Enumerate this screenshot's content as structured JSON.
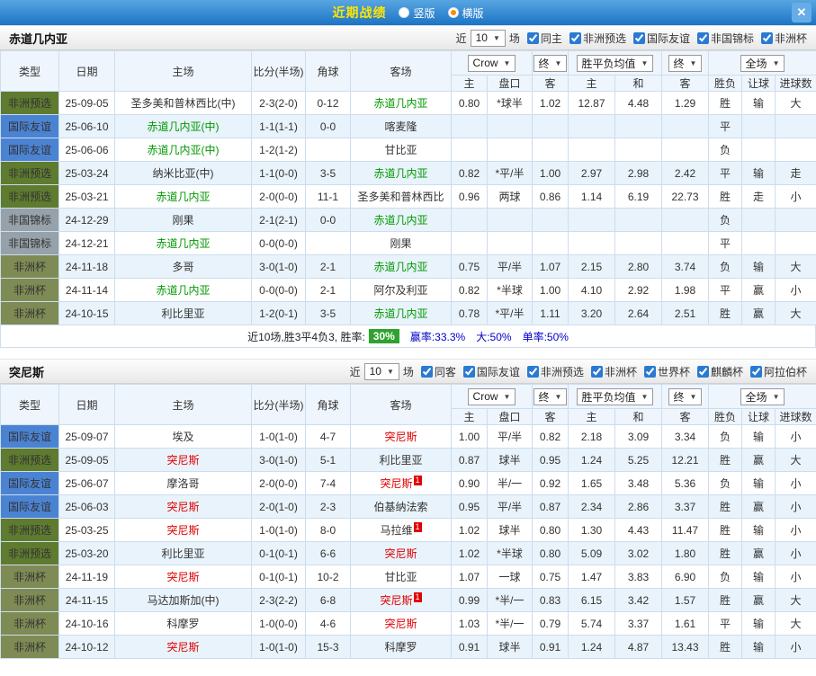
{
  "topbar": {
    "title": "近期战绩",
    "radios": [
      {
        "label": "竖版",
        "selected": false
      },
      {
        "label": "横版",
        "selected": true
      }
    ],
    "close_label": "✕"
  },
  "table_header": {
    "type": "类型",
    "date": "日期",
    "home": "主场",
    "score": "比分(半场)",
    "corners": "角球",
    "away": "客场",
    "odds_home": "主",
    "handicap": "盘口",
    "odds_away": "客",
    "eu_home": "主",
    "eu_draw": "和",
    "eu_away": "客",
    "result": "胜负",
    "let_col": "让球",
    "goals": "进球数"
  },
  "colors": {
    "accent_blue": "#1b74c4",
    "title_yellow": "#ffe400",
    "win_red": "#e00000",
    "lose_green": "#009900",
    "push_blue": "#0000cc",
    "badge_green": "#2fa32f",
    "type_preliminary_green": "#5e7b2f",
    "type_friendly_blue": "#4b83d3",
    "type_nonnational_gray": "#97a1a9",
    "type_africacup_olive": "#7f8b55"
  },
  "sections": [
    {
      "team": "赤道几内亚",
      "recent": {
        "pre": "近",
        "count": "10",
        "post": "场"
      },
      "filters": [
        {
          "label": "同主",
          "checked": true
        },
        {
          "label": "非洲预选",
          "checked": true
        },
        {
          "label": "国际友谊",
          "checked": true
        },
        {
          "label": "非国锦标",
          "checked": true
        },
        {
          "label": "非洲杯",
          "checked": true
        }
      ],
      "dropdowns": {
        "company": "Crow",
        "company_state": "终",
        "europe": "胜平负均值",
        "europe_state": "终",
        "scope": "全场"
      },
      "rows": [
        {
          "type": "非洲预选",
          "typeClass": "t-pre",
          "date": "25-09-05",
          "home": "圣多美和普林西比(中)",
          "homeClass": "",
          "homeBadge": "",
          "score": "2-3(2-0)",
          "corners": "0-12",
          "away": "赤道几内亚",
          "awayClass": "c-green",
          "awayBadge": "",
          "oh": "0.80",
          "hc": "*球半",
          "oa": "1.02",
          "eh": "12.87",
          "ed": "4.48",
          "ea": "1.29",
          "res": "胜",
          "resClass": "c-red",
          "let": "输",
          "letClass": "c-green",
          "big": "大",
          "bigClass": "c-red"
        },
        {
          "type": "国际友谊",
          "typeClass": "t-fri",
          "date": "25-06-10",
          "home": "赤道几内亚(中)",
          "homeClass": "c-green",
          "homeBadge": "",
          "score": "1-1(1-1)",
          "corners": "0-0",
          "away": "喀麦隆",
          "awayClass": "",
          "awayBadge": "",
          "oh": "",
          "hc": "",
          "oa": "",
          "eh": "",
          "ed": "",
          "ea": "",
          "res": "平",
          "resClass": "c-dark",
          "let": "",
          "letClass": "",
          "big": "",
          "bigClass": ""
        },
        {
          "type": "国际友谊",
          "typeClass": "t-fri",
          "date": "25-06-06",
          "home": "赤道几内亚(中)",
          "homeClass": "c-green",
          "homeBadge": "",
          "score": "1-2(1-2)",
          "corners": "",
          "away": "甘比亚",
          "awayClass": "",
          "awayBadge": "",
          "oh": "",
          "hc": "",
          "oa": "",
          "eh": "",
          "ed": "",
          "ea": "",
          "res": "负",
          "resClass": "c-green",
          "let": "",
          "letClass": "",
          "big": "",
          "bigClass": ""
        },
        {
          "type": "非洲预选",
          "typeClass": "t-pre",
          "date": "25-03-24",
          "home": "纳米比亚(中)",
          "homeClass": "",
          "homeBadge": "",
          "score": "1-1(0-0)",
          "corners": "3-5",
          "away": "赤道几内亚",
          "awayClass": "c-green",
          "awayBadge": "",
          "oh": "0.82",
          "hc": "*平/半",
          "oa": "1.00",
          "eh": "2.97",
          "ed": "2.98",
          "ea": "2.42",
          "res": "平",
          "resClass": "c-dark",
          "let": "输",
          "letClass": "c-green",
          "big": "走",
          "bigClass": "c-blue"
        },
        {
          "type": "非洲预选",
          "typeClass": "t-pre",
          "date": "25-03-21",
          "home": "赤道几内亚",
          "homeClass": "c-green",
          "homeBadge": "",
          "score": "2-0(0-0)",
          "corners": "11-1",
          "away": "圣多美和普林西比",
          "awayClass": "",
          "awayBadge": "",
          "oh": "0.96",
          "hc": "两球",
          "oa": "0.86",
          "eh": "1.14",
          "ed": "6.19",
          "ea": "22.73",
          "res": "胜",
          "resClass": "c-red",
          "let": "走",
          "letClass": "c-blue",
          "big": "小",
          "bigClass": "c-blue"
        },
        {
          "type": "非国锦标",
          "typeClass": "t-non",
          "date": "24-12-29",
          "home": "刚果",
          "homeClass": "",
          "homeBadge": "",
          "score": "2-1(2-1)",
          "corners": "0-0",
          "away": "赤道几内亚",
          "awayClass": "c-green",
          "awayBadge": "",
          "oh": "",
          "hc": "",
          "oa": "",
          "eh": "",
          "ed": "",
          "ea": "",
          "res": "负",
          "resClass": "c-green",
          "let": "",
          "letClass": "",
          "big": "",
          "bigClass": ""
        },
        {
          "type": "非国锦标",
          "typeClass": "t-non",
          "date": "24-12-21",
          "home": "赤道几内亚",
          "homeClass": "c-green",
          "homeBadge": "",
          "score": "0-0(0-0)",
          "corners": "",
          "away": "刚果",
          "awayClass": "",
          "awayBadge": "",
          "oh": "",
          "hc": "",
          "oa": "",
          "eh": "",
          "ed": "",
          "ea": "",
          "res": "平",
          "resClass": "c-dark",
          "let": "",
          "letClass": "",
          "big": "",
          "bigClass": ""
        },
        {
          "type": "非洲杯",
          "typeClass": "t-afr",
          "date": "24-11-18",
          "home": "多哥",
          "homeClass": "",
          "homeBadge": "",
          "score": "3-0(1-0)",
          "corners": "2-1",
          "away": "赤道几内亚",
          "awayClass": "c-green",
          "awayBadge": "",
          "oh": "0.75",
          "hc": "平/半",
          "oa": "1.07",
          "eh": "2.15",
          "ed": "2.80",
          "ea": "3.74",
          "res": "负",
          "resClass": "c-green",
          "let": "输",
          "letClass": "c-green",
          "big": "大",
          "bigClass": "c-red"
        },
        {
          "type": "非洲杯",
          "typeClass": "t-afr",
          "date": "24-11-14",
          "home": "赤道几内亚",
          "homeClass": "c-green",
          "homeBadge": "",
          "score": "0-0(0-0)",
          "corners": "2-1",
          "away": "阿尔及利亚",
          "awayClass": "",
          "awayBadge": "",
          "oh": "0.82",
          "hc": "*半球",
          "oa": "1.00",
          "eh": "4.10",
          "ed": "2.92",
          "ea": "1.98",
          "res": "平",
          "resClass": "c-dark",
          "let": "赢",
          "letClass": "c-red",
          "big": "小",
          "bigClass": "c-blue"
        },
        {
          "type": "非洲杯",
          "typeClass": "t-afr",
          "date": "24-10-15",
          "home": "利比里亚",
          "homeClass": "",
          "homeBadge": "",
          "score": "1-2(0-1)",
          "corners": "3-5",
          "away": "赤道几内亚",
          "awayClass": "c-green",
          "awayBadge": "",
          "oh": "0.78",
          "hc": "*平/半",
          "oa": "1.11",
          "eh": "3.20",
          "ed": "2.64",
          "ea": "2.51",
          "res": "胜",
          "resClass": "c-red",
          "let": "赢",
          "letClass": "c-red",
          "big": "大",
          "bigClass": "c-red"
        }
      ],
      "summary": {
        "text": "近10场,胜3平4负3, 胜率:",
        "badge": "30%",
        "stats": [
          "赢率:33.3%",
          "大:50%",
          "单率:50%"
        ]
      }
    },
    {
      "team": "突尼斯",
      "recent": {
        "pre": "近",
        "count": "10",
        "post": "场"
      },
      "filters": [
        {
          "label": "同客",
          "checked": true
        },
        {
          "label": "国际友谊",
          "checked": true
        },
        {
          "label": "非洲预选",
          "checked": true
        },
        {
          "label": "非洲杯",
          "checked": true
        },
        {
          "label": "世界杯",
          "checked": true
        },
        {
          "label": "麒麟杯",
          "checked": true
        },
        {
          "label": "阿拉伯杯",
          "checked": true
        }
      ],
      "dropdowns": {
        "company": "Crow",
        "company_state": "终",
        "europe": "胜平负均值",
        "europe_state": "终",
        "scope": "全场"
      },
      "rows": [
        {
          "type": "国际友谊",
          "typeClass": "t-fri",
          "date": "25-09-07",
          "home": "埃及",
          "homeClass": "",
          "homeBadge": "",
          "score": "1-0(1-0)",
          "corners": "4-7",
          "away": "突尼斯",
          "awayClass": "c-red",
          "awayBadge": "",
          "oh": "1.00",
          "hc": "平/半",
          "oa": "0.82",
          "eh": "2.18",
          "ed": "3.09",
          "ea": "3.34",
          "res": "负",
          "resClass": "c-green",
          "let": "输",
          "letClass": "c-green",
          "big": "小",
          "bigClass": "c-blue"
        },
        {
          "type": "非洲预选",
          "typeClass": "t-pre",
          "date": "25-09-05",
          "home": "突尼斯",
          "homeClass": "c-red",
          "homeBadge": "",
          "score": "3-0(1-0)",
          "corners": "5-1",
          "away": "利比里亚",
          "awayClass": "",
          "awayBadge": "",
          "oh": "0.87",
          "hc": "球半",
          "oa": "0.95",
          "eh": "1.24",
          "ed": "5.25",
          "ea": "12.21",
          "res": "胜",
          "resClass": "c-red",
          "let": "赢",
          "letClass": "c-red",
          "big": "大",
          "bigClass": "c-red"
        },
        {
          "type": "国际友谊",
          "typeClass": "t-fri",
          "date": "25-06-07",
          "home": "摩洛哥",
          "homeClass": "",
          "homeBadge": "",
          "score": "2-0(0-0)",
          "corners": "7-4",
          "away": "突尼斯",
          "awayClass": "c-red",
          "awayBadge": "1",
          "oh": "0.90",
          "hc": "半/一",
          "oa": "0.92",
          "eh": "1.65",
          "ed": "3.48",
          "ea": "5.36",
          "res": "负",
          "resClass": "c-green",
          "let": "输",
          "letClass": "c-green",
          "big": "小",
          "bigClass": "c-blue"
        },
        {
          "type": "国际友谊",
          "typeClass": "t-fri",
          "date": "25-06-03",
          "home": "突尼斯",
          "homeClass": "c-red",
          "homeBadge": "",
          "score": "2-0(1-0)",
          "corners": "2-3",
          "away": "伯基纳法索",
          "awayClass": "",
          "awayBadge": "",
          "oh": "0.95",
          "hc": "平/半",
          "oa": "0.87",
          "eh": "2.34",
          "ed": "2.86",
          "ea": "3.37",
          "res": "胜",
          "resClass": "c-red",
          "let": "赢",
          "letClass": "c-red",
          "big": "小",
          "bigClass": "c-blue"
        },
        {
          "type": "非洲预选",
          "typeClass": "t-pre",
          "date": "25-03-25",
          "home": "突尼斯",
          "homeClass": "c-red",
          "homeBadge": "",
          "score": "1-0(1-0)",
          "corners": "8-0",
          "away": "马拉维",
          "awayClass": "",
          "awayBadge": "1",
          "oh": "1.02",
          "hc": "球半",
          "oa": "0.80",
          "eh": "1.30",
          "ed": "4.43",
          "ea": "11.47",
          "res": "胜",
          "resClass": "c-red",
          "let": "输",
          "letClass": "c-green",
          "big": "小",
          "bigClass": "c-blue"
        },
        {
          "type": "非洲预选",
          "typeClass": "t-pre",
          "date": "25-03-20",
          "home": "利比里亚",
          "homeClass": "",
          "homeBadge": "",
          "score": "0-1(0-1)",
          "corners": "6-6",
          "away": "突尼斯",
          "awayClass": "c-red",
          "awayBadge": "",
          "oh": "1.02",
          "hc": "*半球",
          "oa": "0.80",
          "eh": "5.09",
          "ed": "3.02",
          "ea": "1.80",
          "res": "胜",
          "resClass": "c-red",
          "let": "赢",
          "letClass": "c-red",
          "big": "小",
          "bigClass": "c-blue"
        },
        {
          "type": "非洲杯",
          "typeClass": "t-afr",
          "date": "24-11-19",
          "home": "突尼斯",
          "homeClass": "c-red",
          "homeBadge": "",
          "score": "0-1(0-1)",
          "corners": "10-2",
          "away": "甘比亚",
          "awayClass": "",
          "awayBadge": "",
          "oh": "1.07",
          "hc": "一球",
          "oa": "0.75",
          "eh": "1.47",
          "ed": "3.83",
          "ea": "6.90",
          "res": "负",
          "resClass": "c-green",
          "let": "输",
          "letClass": "c-green",
          "big": "小",
          "bigClass": "c-blue"
        },
        {
          "type": "非洲杯",
          "typeClass": "t-afr",
          "date": "24-11-15",
          "home": "马达加斯加(中)",
          "homeClass": "",
          "homeBadge": "",
          "score": "2-3(2-2)",
          "corners": "6-8",
          "away": "突尼斯",
          "awayClass": "c-red",
          "awayBadge": "1",
          "oh": "0.99",
          "hc": "*半/一",
          "oa": "0.83",
          "eh": "6.15",
          "ed": "3.42",
          "ea": "1.57",
          "res": "胜",
          "resClass": "c-red",
          "let": "赢",
          "letClass": "c-red",
          "big": "大",
          "bigClass": "c-red"
        },
        {
          "type": "非洲杯",
          "typeClass": "t-afr",
          "date": "24-10-16",
          "home": "科摩罗",
          "homeClass": "",
          "homeBadge": "",
          "score": "1-0(0-0)",
          "corners": "4-6",
          "away": "突尼斯",
          "awayClass": "c-red",
          "awayBadge": "",
          "oh": "1.03",
          "hc": "*半/一",
          "oa": "0.79",
          "eh": "5.74",
          "ed": "3.37",
          "ea": "1.61",
          "res": "平",
          "resClass": "c-dark",
          "let": "输",
          "letClass": "c-green",
          "big": "大",
          "bigClass": "c-red"
        },
        {
          "type": "非洲杯",
          "typeClass": "t-afr",
          "date": "24-10-12",
          "home": "突尼斯",
          "homeClass": "c-red",
          "homeBadge": "",
          "score": "1-0(1-0)",
          "corners": "15-3",
          "away": "科摩罗",
          "awayClass": "",
          "awayBadge": "",
          "oh": "0.91",
          "hc": "球半",
          "oa": "0.91",
          "eh": "1.24",
          "ed": "4.87",
          "ea": "13.43",
          "res": "胜",
          "resClass": "c-red",
          "let": "输",
          "letClass": "c-green",
          "big": "小",
          "bigClass": "c-blue"
        }
      ],
      "summary": null
    }
  ]
}
